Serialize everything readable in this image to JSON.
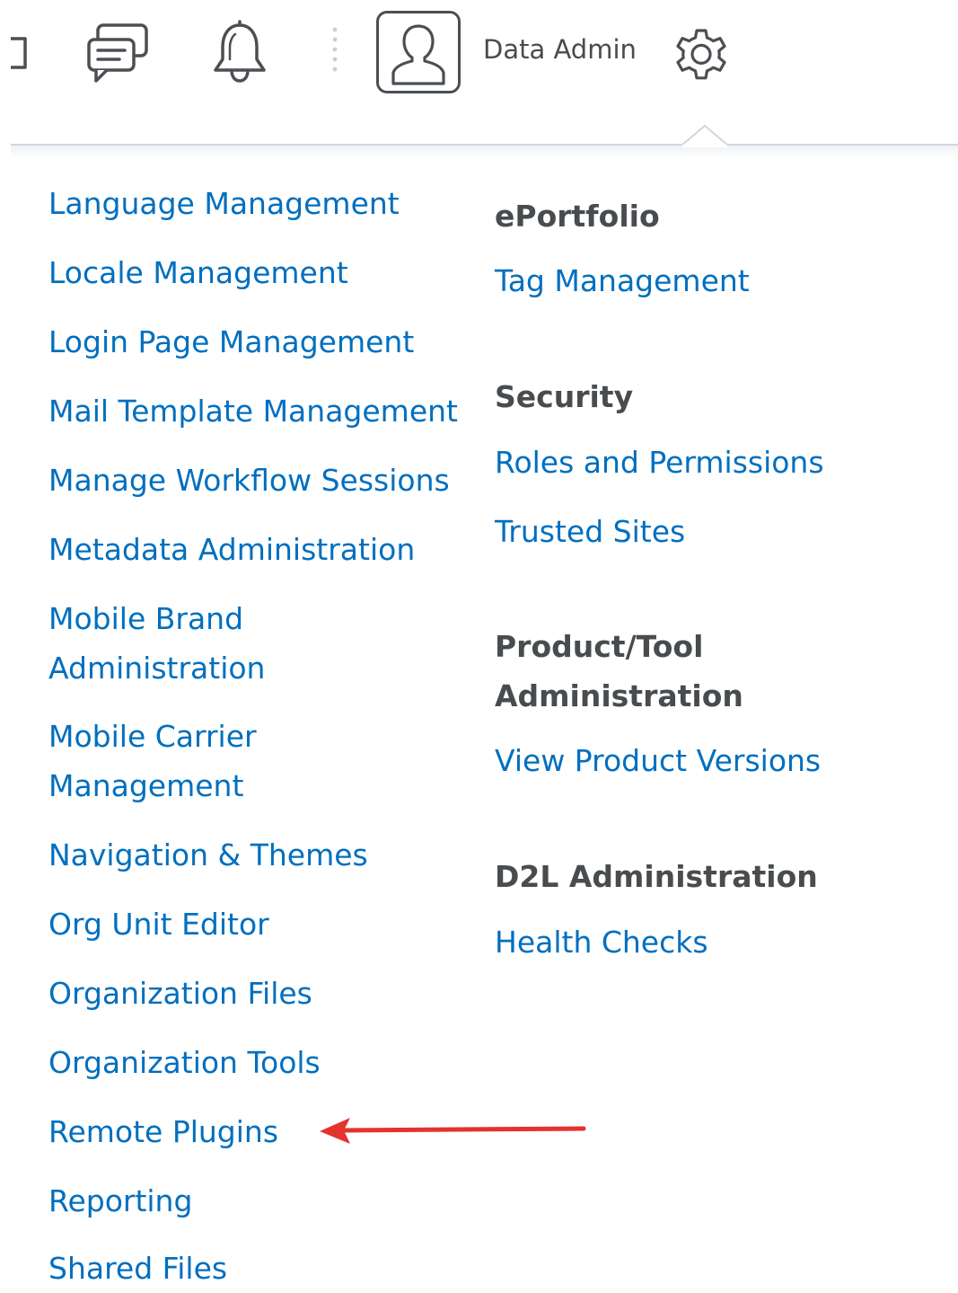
{
  "header": {
    "user_name": "Data Admin",
    "icons": [
      "partial-icon",
      "chat-bubbles-icon",
      "bell-icon",
      "vertical-divider",
      "user-avatar-icon",
      "gear-icon"
    ]
  },
  "menu": {
    "left_column": [
      "Language Management",
      "Locale Management",
      "Login Page Management",
      "Mail Template Management",
      "Manage Workflow Sessions",
      "Metadata Administration",
      "Mobile Brand Administration",
      "Mobile Carrier Management",
      "Navigation & Themes",
      "Org Unit Editor",
      "Organization Files",
      "Organization Tools",
      "Remote Plugins",
      "Reporting",
      "Shared Files"
    ],
    "right_column": {
      "eportfolio": {
        "heading": "ePortfolio",
        "items": [
          "Tag Management"
        ]
      },
      "security": {
        "heading": "Security",
        "items": [
          "Roles and Permissions",
          "Trusted Sites"
        ]
      },
      "product_tool": {
        "heading": "Product/Tool Administration",
        "items": [
          "View Product Versions"
        ]
      },
      "d2l_admin": {
        "heading": "D2L Administration",
        "items": [
          "Health Checks"
        ]
      }
    }
  },
  "annotation": {
    "arrow_color": "#e5322d",
    "points_to": "Remote Plugins"
  },
  "colors": {
    "link": "#006fbf",
    "heading": "#494c4e",
    "icon": "#4b4f54"
  }
}
